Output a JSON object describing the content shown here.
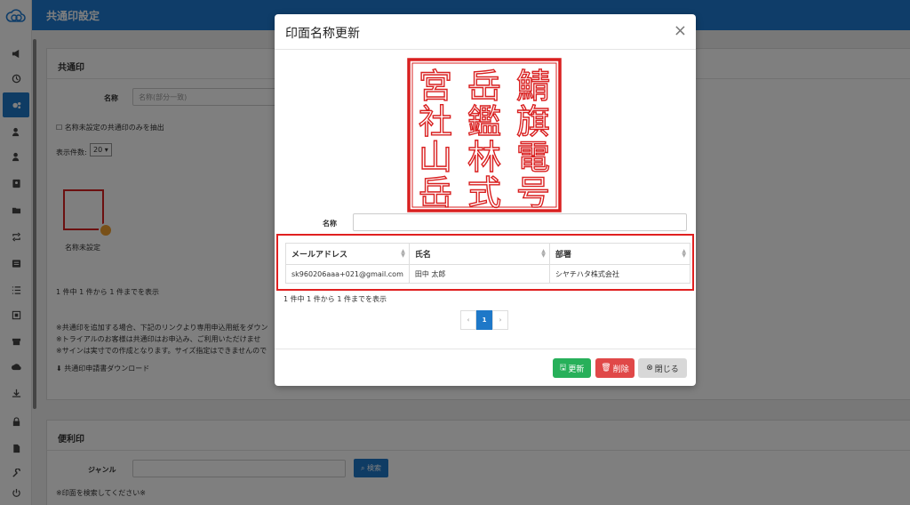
{
  "header": {
    "title": "共通印設定"
  },
  "sidebar": {
    "icons": [
      "megaphone-icon",
      "history-icon",
      "settings-icon",
      "user-settings-icon",
      "user-icon",
      "contact-card-icon",
      "folder-icon",
      "retweet-icon",
      "list-box-icon",
      "list-icon",
      "seal-icon",
      "archive-icon",
      "cloud-upload-icon",
      "download-icon",
      "lock-icon",
      "file-icon",
      "wrench-icon",
      "power-icon"
    ]
  },
  "common_seal_panel": {
    "title": "共通印",
    "name_label": "名称",
    "name_placeholder": "名称(部分一致)",
    "checkbox_label": "名称未設定の共通印のみを抽出",
    "per_page_label": "表示件数:",
    "per_page_value": "20",
    "stamp_caption": "名称未設定",
    "count_info": "1 件中 1 件から 1 件までを表示",
    "notes": [
      "※共通印を追加する場合、下記のリンクより専用申込用紙をダウン",
      "※トライアルのお客様は共通印はお申込み、ご利用いただけませ",
      "※サインは実寸での作成となります。サイズ指定はできませんので"
    ],
    "download_link": "共通印申請書ダウンロード"
  },
  "convenient_panel": {
    "title": "便利印",
    "genre_label": "ジャンル",
    "search_button": "検索",
    "note": "※印面を検索してください※"
  },
  "modal": {
    "title": "印面名称更新",
    "close": "×",
    "seal_rows": [
      [
        "宮",
        "岳",
        "鯖"
      ],
      [
        "社",
        "鑑",
        "旗"
      ],
      [
        "山",
        "林",
        "電"
      ],
      [
        "岳",
        "式",
        "号"
      ]
    ],
    "name_label": "名称",
    "name_value": "",
    "table": {
      "headers": [
        "メールアドレス",
        "氏名",
        "部署"
      ],
      "rows": [
        [
          "sk960206aaa+021@gmail.com",
          "田中 太郎",
          "シヤチハタ株式会社"
        ]
      ]
    },
    "count_info": "1 件中 1 件から 1 件までを表示",
    "pager": {
      "prev": "‹",
      "current": "1",
      "next": "›"
    },
    "buttons": {
      "update": "更新",
      "delete": "削除",
      "close": "閉じる"
    }
  },
  "colors": {
    "primary": "#1f7bd2",
    "seal_red": "#d92020",
    "update": "#27b05a",
    "delete": "#e04848"
  }
}
